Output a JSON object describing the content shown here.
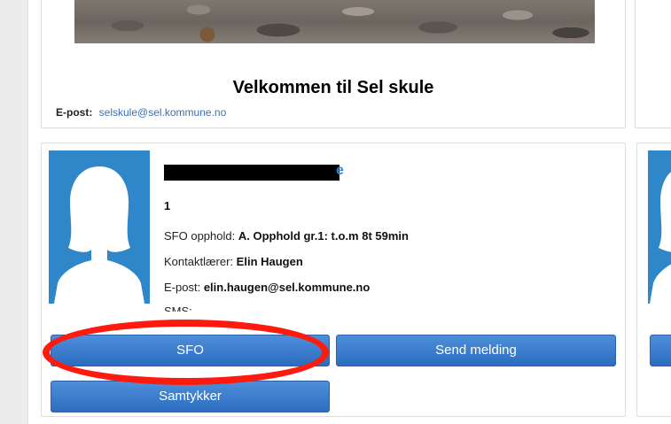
{
  "school": {
    "title": "Velkommen til Sel skule",
    "email_label": "E-post:",
    "email": "selskule@sel.kommune.no"
  },
  "student": {
    "name_visible_fragment": "e",
    "grade": "1",
    "sfo_label": "SFO opphold:",
    "sfo_value": "A. Opphold gr.1: t.o.m 8t 59min",
    "contact_label": "Kontaktlærer:",
    "contact_value": "Elin Haugen",
    "email_label": "E-post:",
    "email_value": "elin.haugen@sel.kommune.no",
    "sms_label": "SMS:"
  },
  "buttons": {
    "sfo": "SFO",
    "send_message": "Send melding",
    "consent": "Samtykker"
  },
  "colors": {
    "button_blue": "#3a7ccc",
    "link_blue": "#3a6fb7",
    "highlight_red": "#ff1a0f",
    "avatar_blue": "#2f86c8"
  },
  "icons": {
    "avatar": "person-silhouette-icon"
  }
}
